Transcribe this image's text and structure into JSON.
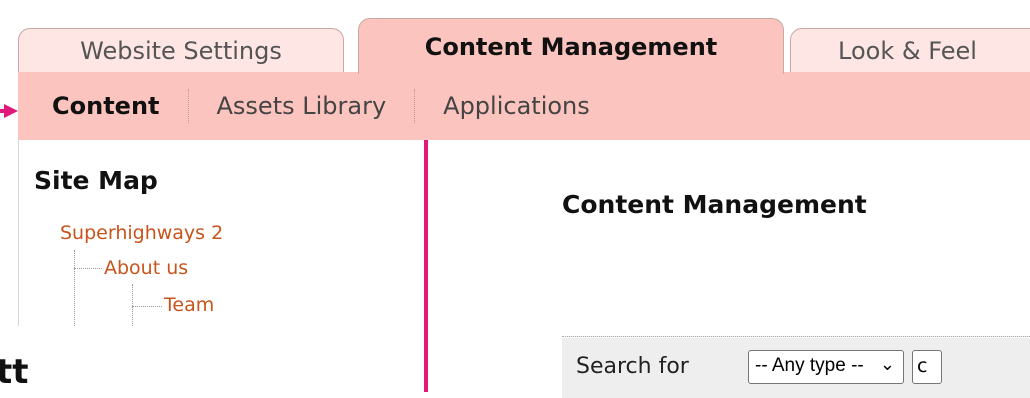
{
  "tabs": [
    {
      "label": "Website Settings",
      "active": false
    },
    {
      "label": "Content Management",
      "active": true
    },
    {
      "label": "Look & Feel",
      "active": false
    }
  ],
  "subnav": [
    {
      "label": "Content",
      "active": true
    },
    {
      "label": "Assets Library",
      "active": false
    },
    {
      "label": "Applications",
      "active": false
    }
  ],
  "sitemap": {
    "title": "Site Map",
    "items": [
      "Superhighways 2",
      "About us",
      "Team"
    ]
  },
  "main": {
    "title": "Content Management",
    "search_label": "Search for",
    "type_select": {
      "value": "-- Any type --"
    },
    "next_field_fragment": "c"
  },
  "bottom_fragment": "tt",
  "colors": {
    "tab_active": "#fcc4be",
    "tab_inactive": "#fde6e3",
    "link": "#c8541c",
    "annotation": "#e0187a"
  }
}
